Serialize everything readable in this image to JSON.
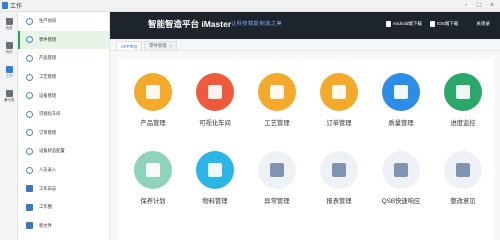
{
  "window": {
    "title": "工作",
    "controls": [
      "-",
      "□",
      "×"
    ]
  },
  "rail": [
    {
      "label": "消息",
      "icon": "chat-icon"
    },
    {
      "label": "待办",
      "icon": "task-icon"
    },
    {
      "label": "工作",
      "icon": "work-icon"
    },
    {
      "label": "通讯录",
      "icon": "contacts-icon"
    }
  ],
  "sidebar": {
    "items": [
      {
        "label": "生产协同",
        "icon": "gear-icon",
        "active": false
      },
      {
        "label": "零件管理",
        "icon": "gear-icon",
        "active": true
      },
      {
        "label": "产品管理",
        "icon": "gear-icon",
        "active": false
      },
      {
        "label": "工艺管理",
        "icon": "gear-icon",
        "active": false
      },
      {
        "label": "设备管理",
        "icon": "gear-icon",
        "active": false
      },
      {
        "label": "可视化车间",
        "icon": "gear-icon",
        "active": false
      },
      {
        "label": "订单管理",
        "icon": "gear-icon",
        "active": false
      },
      {
        "label": "设备状态配置",
        "icon": "gear-icon",
        "active": false
      },
      {
        "label": "人员录入",
        "icon": "gear-icon",
        "active": false
      },
      {
        "label": "工作日志",
        "icon": "doc-icon",
        "active": false
      },
      {
        "label": "工作圈",
        "icon": "circle-icon",
        "active": false
      },
      {
        "label": "新文件",
        "icon": "file-icon",
        "active": false
      }
    ]
  },
  "header": {
    "brand": "智能智造平台 iMaster",
    "slogan": "让科技赋能制造之美",
    "android": "Android端下载",
    "ios": "IOS端下载",
    "logout": "关闭录"
  },
  "tabs": [
    {
      "label": "APPIRQ",
      "active": true
    },
    {
      "label": "零件管理",
      "active": false
    }
  ],
  "tiles": [
    {
      "label": "产品管理",
      "color": "#f4a92b"
    },
    {
      "label": "可视化车间",
      "color": "#ee5a3b"
    },
    {
      "label": "工艺管理",
      "color": "#f4a92b"
    },
    {
      "label": "订单管理",
      "color": "#f4a92b"
    },
    {
      "label": "质量管理",
      "color": "#2b8de8"
    },
    {
      "label": "进度监控",
      "color": "#2ba76a"
    },
    {
      "label": "保养计划",
      "color": "#8fd3be"
    },
    {
      "label": "物料管理",
      "color": "#2bb6e6"
    },
    {
      "label": "异常管理",
      "color": "#eef1f5"
    },
    {
      "label": "报表管理",
      "color": "#eef1f5"
    },
    {
      "label": "QSB快速响应",
      "color": "#eef1f5"
    },
    {
      "label": "整改意见",
      "color": "#eef1f5"
    }
  ]
}
